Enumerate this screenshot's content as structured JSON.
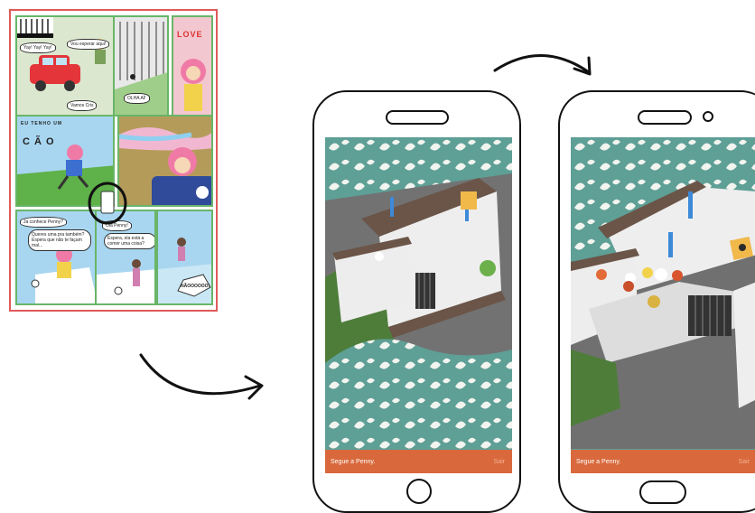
{
  "comic": {
    "bubbles": {
      "yay": "Yay! Yay! Yay!",
      "espera": "Vou esperar aqui!",
      "vamos": "Vamos Cris",
      "olha": "OLHA AÍ!",
      "conhece": "Já conhece Penny?",
      "quer": "Queres uma pra também? Espera que não te façam mal...",
      "ola": "Olá Penny!",
      "comer": "Espera, ela está a comer uma coisa?",
      "nao": "NÃOOOOOO!"
    },
    "love": "LOVE",
    "eu_tenho": "EU TENHO UM",
    "cao": "C Ã O"
  },
  "phone_left": {
    "bar_text": "Segue a Penny.",
    "bar_button": "Sair"
  },
  "phone_right": {
    "bar_text": "Segue a Penny.",
    "bar_button": "Sair"
  },
  "colors": {
    "accent": "#d9693c",
    "comic_border": "#e05a5a",
    "panel_border": "#69b567"
  },
  "icons": [
    "arrow-down-right-icon",
    "arrow-right-curved-icon",
    "paw-icon"
  ]
}
